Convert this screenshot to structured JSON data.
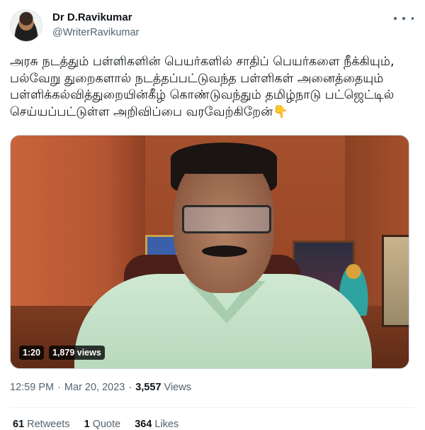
{
  "author": {
    "name": "Dr D.Ravikumar",
    "handle": "@WriterRavikumar"
  },
  "tweet": {
    "text": "அரசு நடத்தும் பள்ளிகளின் பெயர்களில் சாதிப் பெயர்களை நீக்கியும், பல்வேறு துறைகளால் நடத்தப்பட்டுவந்த பள்ளிகள் அனைத்தையும் பள்ளிக்கல்வித்துறையின்கீழ் கொண்டுவந்தும் தமிழ்நாடு பட்ஜெட்டில் செய்யப்பட்டுள்ள அறிவிப்பை வரவேற்கிறேன்",
    "emoji": "👇"
  },
  "video": {
    "duration": "1:20",
    "views": "1,879 views"
  },
  "meta": {
    "time": "12:59 PM",
    "separator": "·",
    "date": "Mar 20, 2023",
    "view_count": "3,557",
    "view_label": "Views"
  },
  "stats": {
    "retweets_count": "61",
    "retweets_label": "Retweets",
    "quotes_count": "1",
    "quotes_label": "Quote",
    "likes_count": "364",
    "likes_label": "Likes"
  },
  "icons": {
    "more": "more-horizontal-icon"
  }
}
